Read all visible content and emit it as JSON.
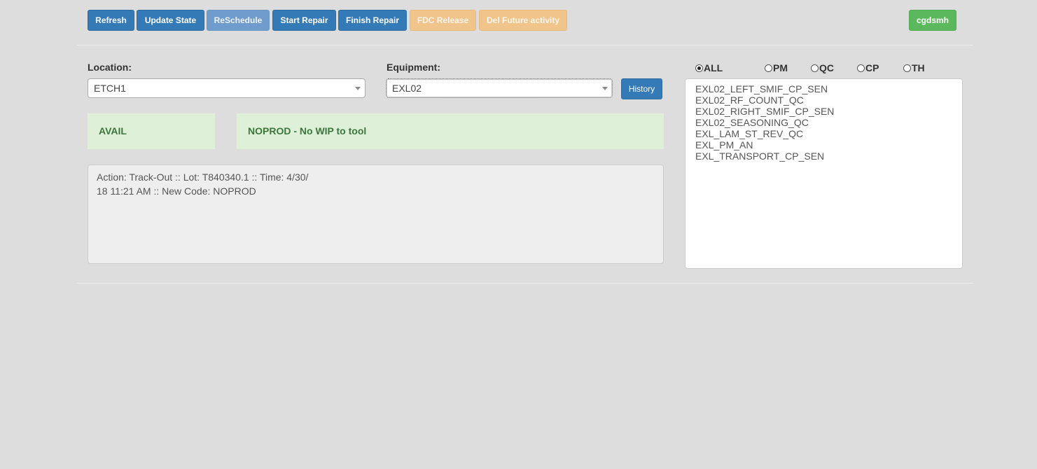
{
  "toolbar": {
    "refresh": "Refresh",
    "update_state": "Update State",
    "reschedule": "ReSchedule",
    "start_repair": "Start Repair",
    "finish_repair": "Finish Repair",
    "fdc_release": "FDC Release",
    "del_future_activity": "Del Future activity",
    "user": "cgdsmh"
  },
  "location": {
    "label": "Location:",
    "value": "ETCH1"
  },
  "equipment": {
    "label": "Equipment:",
    "value": "EXL02",
    "history_button": "History"
  },
  "status": {
    "state": "AVAIL",
    "code_message": "NOPROD - No WIP to tool"
  },
  "log": {
    "line1": "Action: Track-Out :: Lot: T840340.1 :: Time: 4/30/",
    "line2": "18 11:21 AM :: New Code: NOPROD"
  },
  "filters": {
    "options": [
      "ALL",
      "PM",
      "QC",
      "CP",
      "TH"
    ],
    "selected": "ALL"
  },
  "activities": [
    "EXL02_LEFT_SMIF_CP_SEN",
    "EXL02_RF_COUNT_QC",
    "EXL02_RIGHT_SMIF_CP_SEN",
    "EXL02_SEASONING_QC",
    "EXL_LAM_ST_REV_QC",
    "EXL_PM_AN",
    "EXL_TRANSPORT_CP_SEN"
  ],
  "colors": {
    "primary": "#337ab7",
    "warning_disabled": "#f0c48a",
    "success": "#5cb85c",
    "status_bg": "#dff0d8",
    "status_text": "#3c763d"
  }
}
